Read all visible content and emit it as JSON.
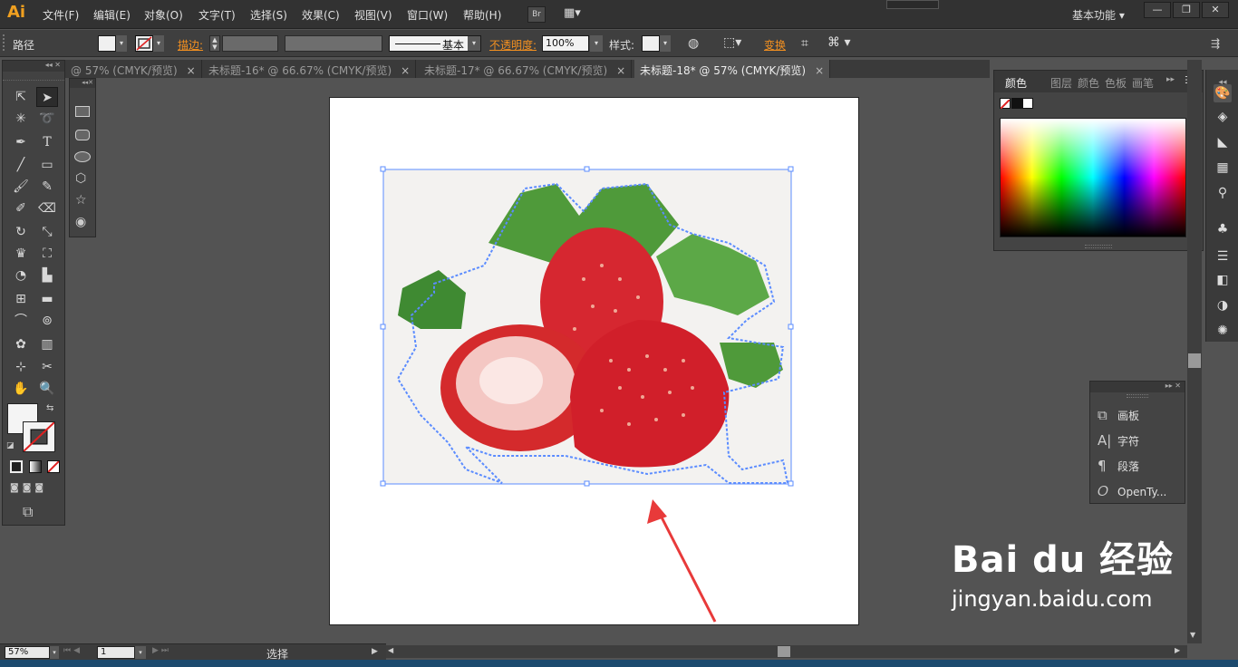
{
  "app": {
    "logo": "Ai"
  },
  "menu": [
    "文件(F)",
    "编辑(E)",
    "对象(O)",
    "文字(T)",
    "选择(S)",
    "效果(C)",
    "视图(V)",
    "窗口(W)",
    "帮助(H)"
  ],
  "bridge_label": "Br",
  "workspace": "基本功能",
  "controlbar": {
    "path_label": "路径",
    "stroke_label": "描边:",
    "stroke_profile": "基本",
    "opacity_label": "不透明度:",
    "opacity_value": "100%",
    "style_label": "样式:",
    "transform_label": "变换"
  },
  "tabs": [
    {
      "label": "@ 57% (CMYK/预览)",
      "close": "×"
    },
    {
      "label": "未标题-16* @ 66.67% (CMYK/预览)",
      "close": "×"
    },
    {
      "label": "未标题-17* @ 66.67% (CMYK/预览)",
      "close": "×"
    },
    {
      "label": "未标题-18* @ 57% (CMYK/预览)",
      "close": "×"
    }
  ],
  "color_panel": {
    "tabs": [
      "颜色",
      "图层",
      "颜色",
      "色板",
      "画笔"
    ]
  },
  "char_panel": {
    "items": [
      {
        "icon": "artboards-icon",
        "label": "画板"
      },
      {
        "icon": "character-icon",
        "label": "字符"
      },
      {
        "icon": "paragraph-icon",
        "label": "段落"
      },
      {
        "icon": "opentype-icon",
        "label": "OpenTy..."
      }
    ]
  },
  "statusbar": {
    "zoom": "57%",
    "page": "1",
    "tool": "选择"
  },
  "watermark": {
    "brand": "Bai du 经验",
    "url": "jingyan.baidu.com"
  },
  "colors": {
    "accent_orange": "#f39020",
    "selection_blue": "#5b8cff",
    "arrow_red": "#e83a3a"
  }
}
